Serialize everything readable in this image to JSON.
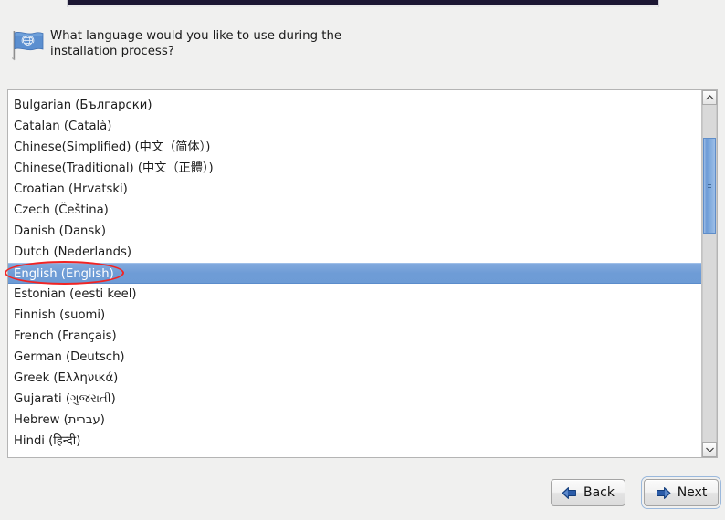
{
  "window": {
    "top_strip_color": "#1c1733"
  },
  "header": {
    "icon": "un-flag-icon",
    "prompt": "What language would you like to use during the installation process?"
  },
  "language_list": {
    "name": "language-list",
    "selected": "English (English)",
    "items": [
      {
        "label": "Bulgarian (Български)",
        "selected": false
      },
      {
        "label": "Catalan (Català)",
        "selected": false
      },
      {
        "label": "Chinese(Simplified) (中文（简体）)",
        "selected": false
      },
      {
        "label": "Chinese(Traditional) (中文（正體）)",
        "selected": false
      },
      {
        "label": "Croatian (Hrvatski)",
        "selected": false
      },
      {
        "label": "Czech (Čeština)",
        "selected": false
      },
      {
        "label": "Danish (Dansk)",
        "selected": false
      },
      {
        "label": "Dutch (Nederlands)",
        "selected": false
      },
      {
        "label": "English (English)",
        "selected": true
      },
      {
        "label": "Estonian (eesti keel)",
        "selected": false
      },
      {
        "label": "Finnish (suomi)",
        "selected": false
      },
      {
        "label": "French (Français)",
        "selected": false
      },
      {
        "label": "German (Deutsch)",
        "selected": false
      },
      {
        "label": "Greek (Ελληνικά)",
        "selected": false
      },
      {
        "label": "Gujarati (ગુજરાતી)",
        "selected": false
      },
      {
        "label": "Hebrew (עברית)",
        "selected": false
      },
      {
        "label": "Hindi (हिन्दी)",
        "selected": false
      }
    ]
  },
  "scrollbar": {
    "up_arrow": "chevron-up-icon",
    "down_arrow": "chevron-down-icon"
  },
  "annotation": {
    "color": "#f12424",
    "target": "English (English)"
  },
  "footer": {
    "back_label": "Back",
    "next_label": "Next",
    "back_icon": "arrow-left-icon",
    "next_icon": "arrow-right-icon",
    "focused_button": "Next",
    "accent_color": "#2a5ba8"
  }
}
